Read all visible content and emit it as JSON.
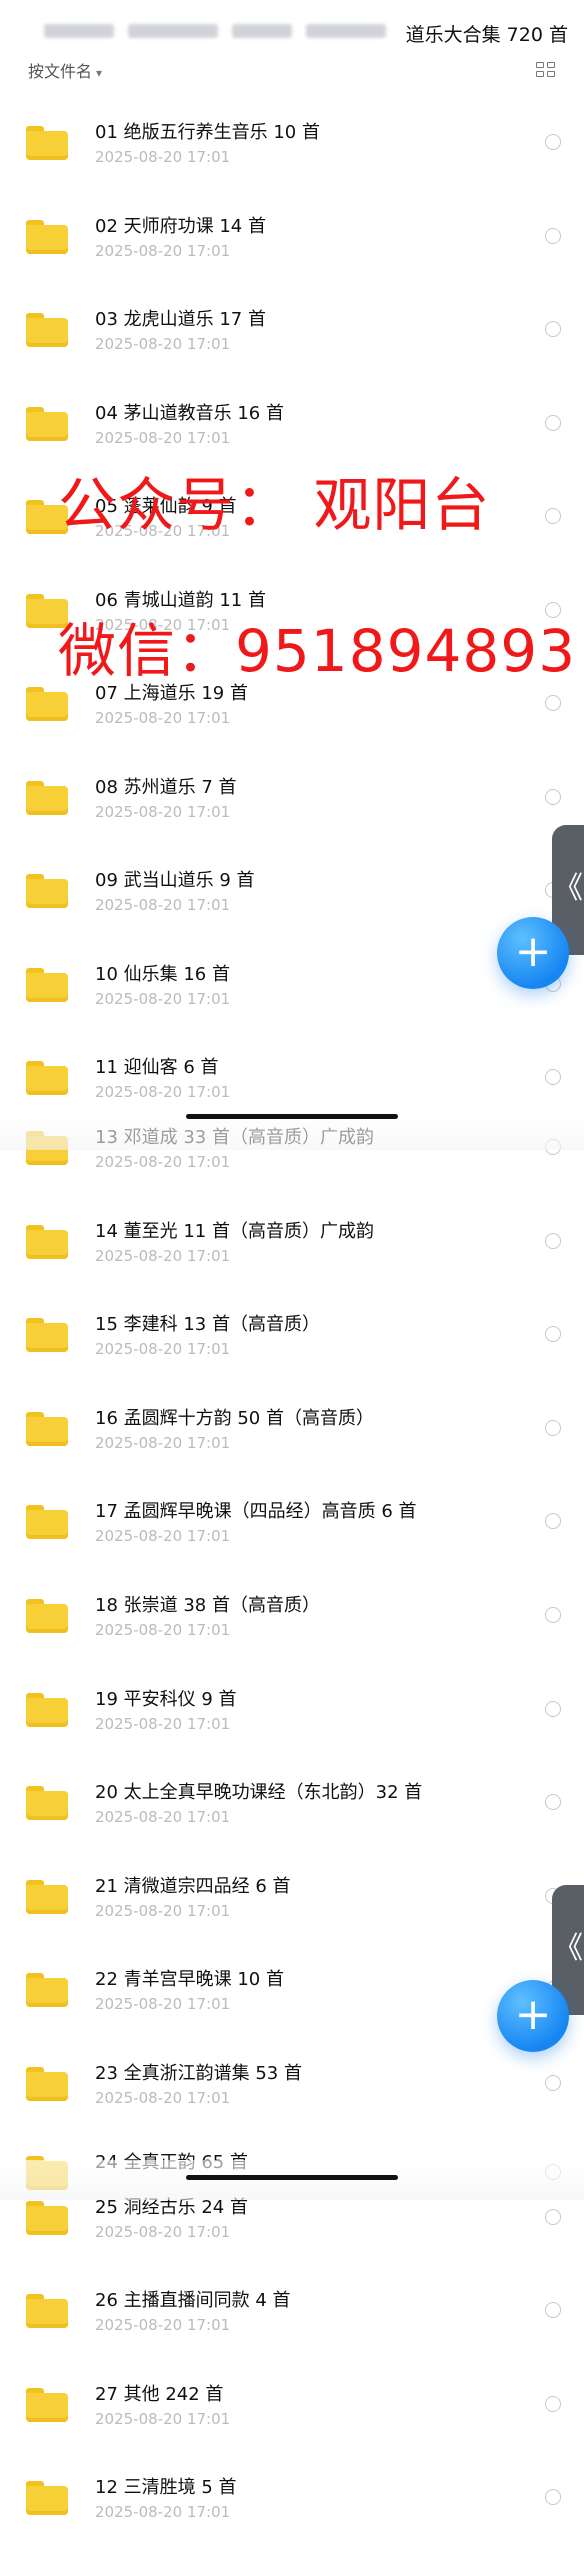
{
  "header": {
    "title": "道乐大合集 720 首",
    "sort_label": "按文件名",
    "grid_icon": "grid-view-icon"
  },
  "watermark": {
    "line1": "公众号： 观阳台",
    "line2": "微信：951894893",
    "color": "#f01818"
  },
  "colors": {
    "folder": "#f7cf36",
    "fab": "#1686f2"
  },
  "fab_label": "+",
  "sidetab_label": "《",
  "files": [
    {
      "name": "01 绝版五行养生音乐 10 首",
      "date": "2025-08-20 17:01"
    },
    {
      "name": "02 天师府功课 14 首",
      "date": "2025-08-20 17:01"
    },
    {
      "name": "03 龙虎山道乐 17 首",
      "date": "2025-08-20 17:01"
    },
    {
      "name": "04 茅山道教音乐 16 首",
      "date": "2025-08-20 17:01"
    },
    {
      "name": "05 蓬莱仙韵 9 首",
      "date": "2025-08-20 17:01"
    },
    {
      "name": "06 青城山道韵 11 首",
      "date": "2025-08-20 17:01"
    },
    {
      "name": "07 上海道乐 19 首",
      "date": "2025-08-20 17:01"
    },
    {
      "name": "08 苏州道乐 7 首",
      "date": "2025-08-20 17:01"
    },
    {
      "name": "09 武当山道乐 9 首",
      "date": "2025-08-20 17:01"
    },
    {
      "name": "10 仙乐集 16 首",
      "date": "2025-08-20 17:01"
    },
    {
      "name": "11 迎仙客 6 首",
      "date": "2025-08-20 17:01"
    },
    {
      "name": "13 邓道成 33 首（高音质）广成韵",
      "date": "2025-08-20 17:01"
    },
    {
      "name": "14 董至光 11 首（高音质）广成韵",
      "date": "2025-08-20 17:01"
    },
    {
      "name": "15 李建科 13 首（高音质）",
      "date": "2025-08-20 17:01"
    },
    {
      "name": "16 孟圆辉十方韵 50 首（高音质）",
      "date": "2025-08-20 17:01"
    },
    {
      "name": "17 孟圆辉早晚课（四品经）高音质 6 首",
      "date": "2025-08-20 17:01"
    },
    {
      "name": "18 张崇道 38 首（高音质）",
      "date": "2025-08-20 17:01"
    },
    {
      "name": "19 平安科仪 9 首",
      "date": "2025-08-20 17:01"
    },
    {
      "name": "20 太上全真早晚功课经（东北韵）32 首",
      "date": "2025-08-20 17:01"
    },
    {
      "name": "21 清微道宗四品经 6 首",
      "date": "2025-08-20 17:01"
    },
    {
      "name": "22 青羊宫早晚课 10 首",
      "date": "2025-08-20 17:01"
    },
    {
      "name": "23 全真浙江韵谱集 53 首",
      "date": "2025-08-20 17:01"
    },
    {
      "name": "24 全真正韵 65 首",
      "date": ""
    },
    {
      "name": "25 洞经古乐 24 首",
      "date": "2025-08-20 17:01"
    },
    {
      "name": "26 主播直播间同款 4 首",
      "date": "2025-08-20 17:01"
    },
    {
      "name": "27 其他 242 首",
      "date": "2025-08-20 17:01"
    },
    {
      "name": "12 三清胜境 5 首",
      "date": "2025-08-20 17:01"
    }
  ]
}
